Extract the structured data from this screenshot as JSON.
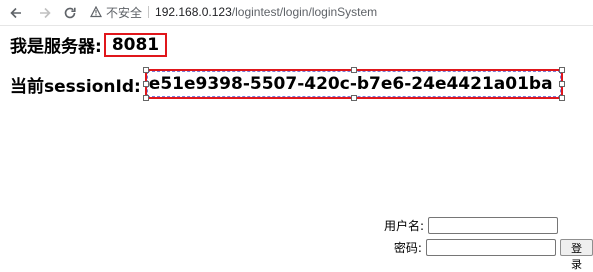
{
  "browser": {
    "back_icon": "arrow-left-icon",
    "forward_icon": "arrow-right-icon",
    "reload_icon": "reload-icon",
    "security_icon": "warning-triangle-icon",
    "insecure_label": "不安全",
    "url_host": "192.168.0.123",
    "url_path": "/logintest/login/loginSystem"
  },
  "page": {
    "server_label": "我是服务器:",
    "server_port": "8081",
    "session_label": "当前sessionId:",
    "session_id": "e51e9398-5507-420c-b7e6-24e4421a01ba"
  },
  "login_form": {
    "username_label": "用户名:",
    "username_value": "",
    "password_label": "密码:",
    "password_value": "",
    "submit_label": "登录"
  },
  "colors": {
    "highlight_border": "#e0161b",
    "selection_dash": "#7a7ad6"
  }
}
